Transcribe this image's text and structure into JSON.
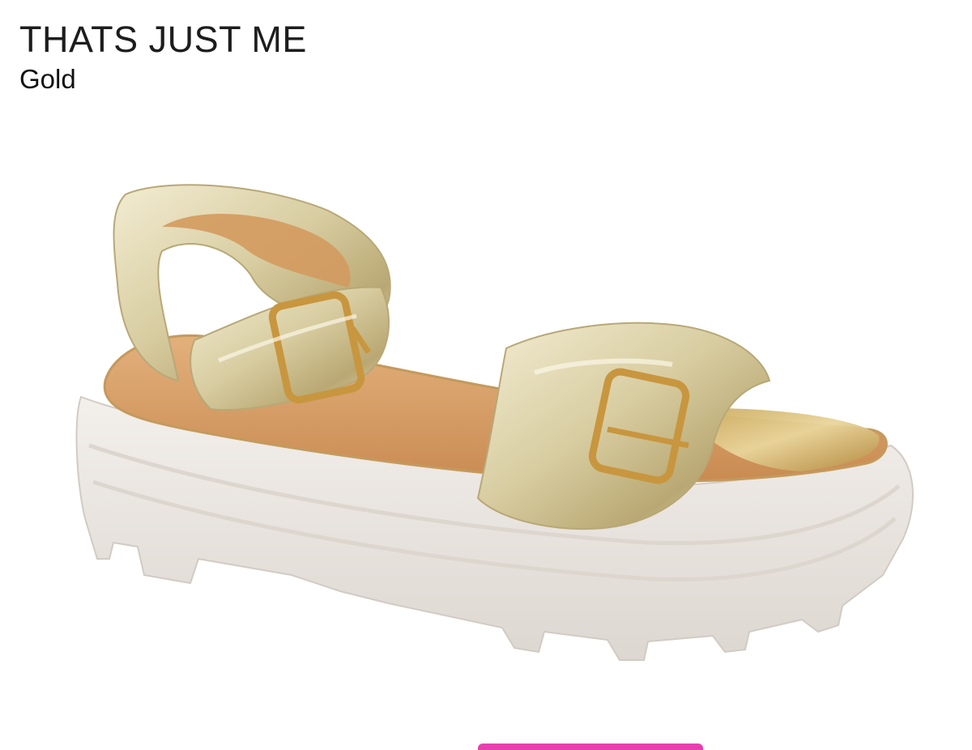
{
  "product": {
    "name": "THATS JUST ME",
    "color": "Gold"
  },
  "image": {
    "icon": "sandal-product-image"
  },
  "colors": {
    "accent_bar": "#e83fae",
    "leather_gold": "#d9cfa6",
    "sole": "#ece7e2",
    "footbed": "#d8a06a"
  }
}
